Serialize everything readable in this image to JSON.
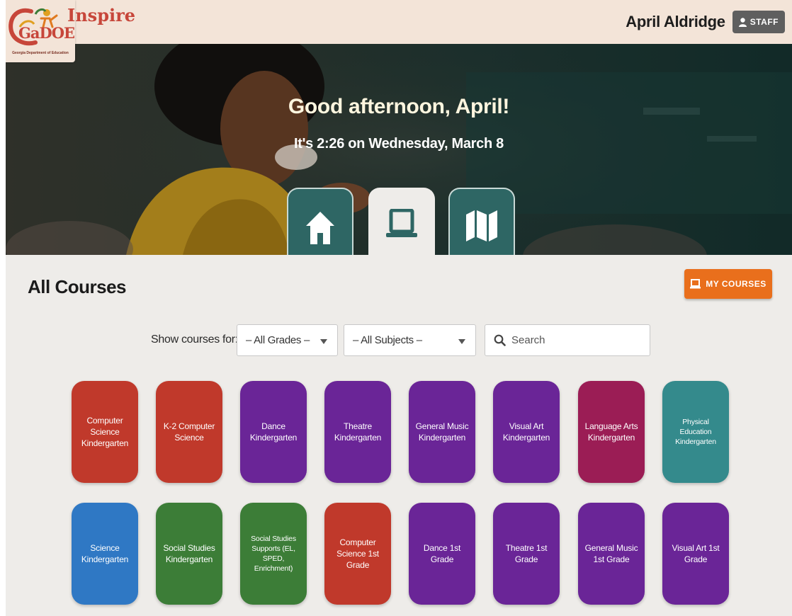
{
  "header": {
    "app_name": "Inspire",
    "logo_text": "GaDOE",
    "logo_caption": "Georgia Department of Education",
    "user_name": "April Aldridge",
    "role_badge": "STAFF"
  },
  "hero": {
    "greeting": "Good afternoon, April!",
    "time_line": "It's 2:26 on Wednesday, March 8",
    "tabs": [
      {
        "icon": "home-icon",
        "active": false
      },
      {
        "icon": "laptop-icon",
        "active": true
      },
      {
        "icon": "map-icon",
        "active": false
      }
    ]
  },
  "main": {
    "title": "All Courses",
    "my_courses_label": "MY COURSES",
    "filter_label": "Show courses for:",
    "grade_select": "– All Grades –",
    "subject_select": "– All Subjects –",
    "search_placeholder": "Search",
    "courses": [
      {
        "label": "Computer Science Kindergarten",
        "color": "#c0392b"
      },
      {
        "label": "K-2 Computer Science",
        "color": "#c0392b"
      },
      {
        "label": "Dance Kindergarten",
        "color": "#6a2597"
      },
      {
        "label": "Theatre Kindergarten",
        "color": "#6a2597"
      },
      {
        "label": "General Music Kindergarten",
        "color": "#6a2597"
      },
      {
        "label": "Visual Art Kindergarten",
        "color": "#6a2597"
      },
      {
        "label": "Language Arts Kindergarten",
        "color": "#9b1d55"
      },
      {
        "label": "Physical Education Kindergarten",
        "color": "#348a8c"
      },
      {
        "label": "Science Kindergarten",
        "color": "#2f78c4"
      },
      {
        "label": "Social Studies Kindergarten",
        "color": "#3c7d37"
      },
      {
        "label": "Social Studies Supports (EL, SPED, Enrichment)",
        "color": "#3c7d37"
      },
      {
        "label": "Computer Science 1st Grade",
        "color": "#c0392b"
      },
      {
        "label": "Dance 1st Grade",
        "color": "#6a2597"
      },
      {
        "label": "Theatre 1st Grade",
        "color": "#6a2597"
      },
      {
        "label": "General Music 1st Grade",
        "color": "#6a2597"
      },
      {
        "label": "Visual Art 1st Grade",
        "color": "#6a2597"
      }
    ]
  },
  "colors": {
    "accent_orange": "#e96f1c",
    "teal": "#2e6664",
    "topbar_bg": "#f3e4d8"
  }
}
